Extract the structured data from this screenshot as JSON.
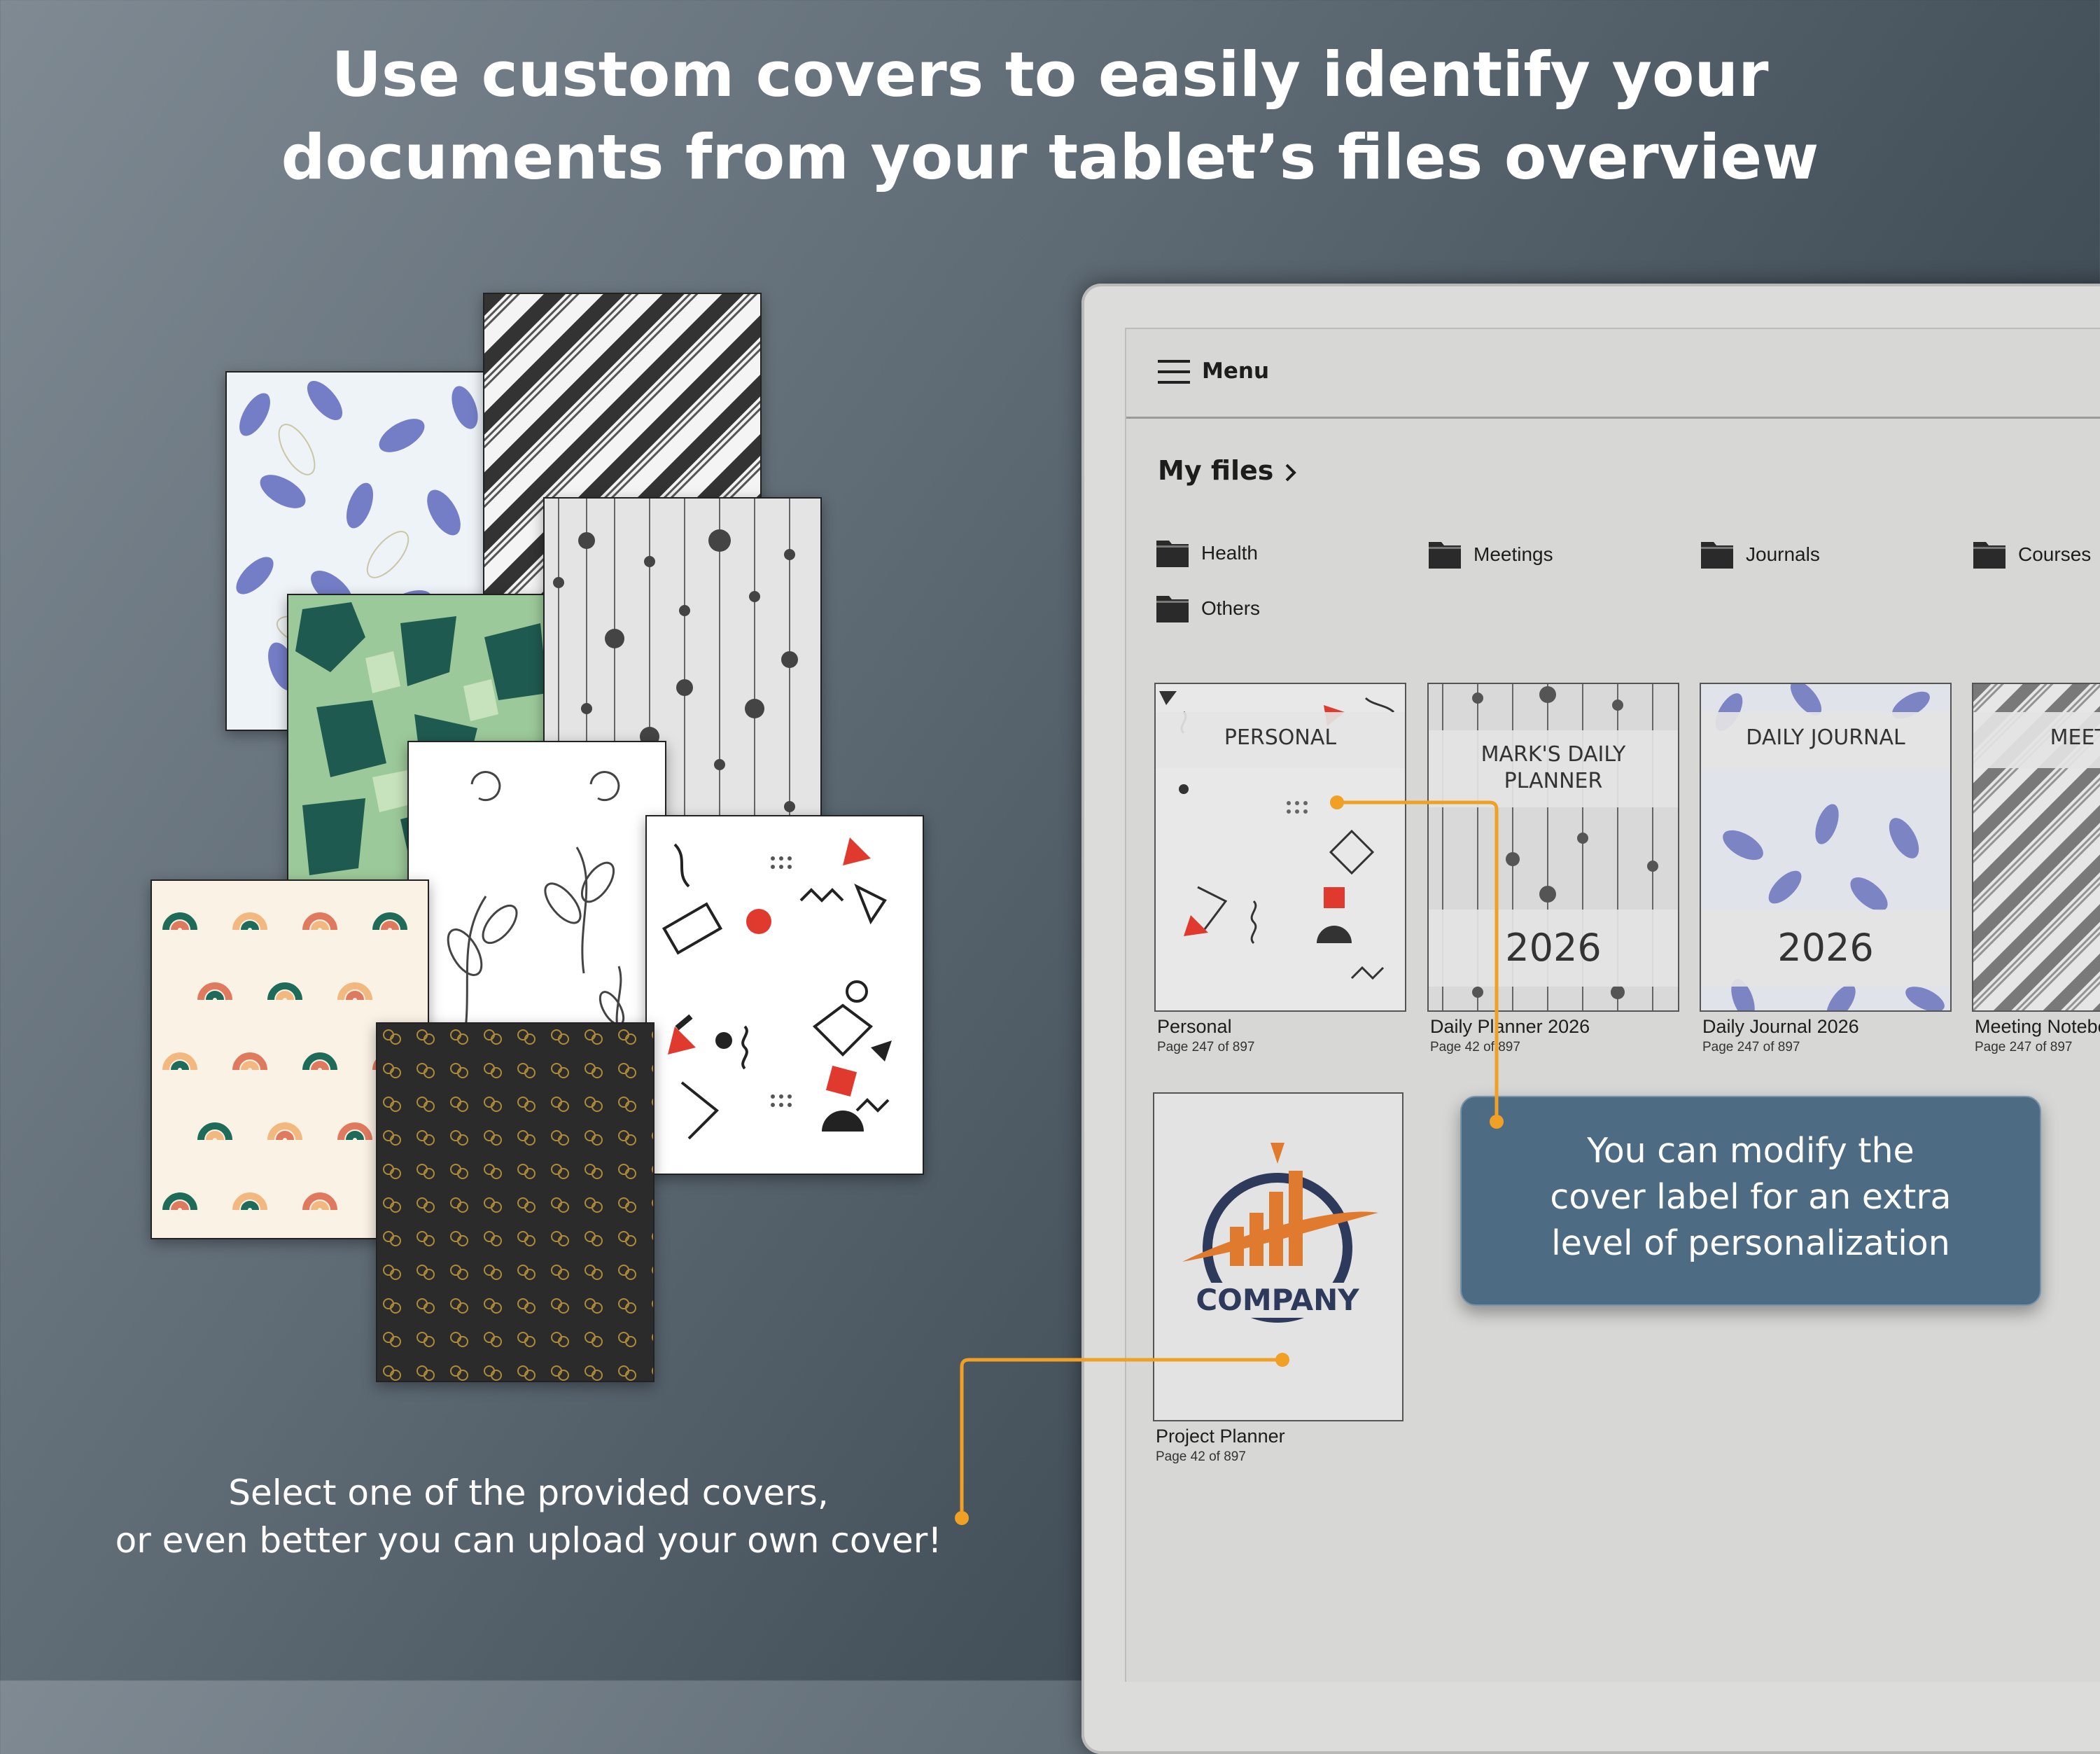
{
  "headline": {
    "line1": "Use custom covers to easily identify your",
    "line2": "documents from your tablet’s files overview"
  },
  "caption": {
    "line1": "Select one of the provided covers,",
    "line2": "or even better you can upload your own cover!"
  },
  "callout": {
    "line1": "You can modify the",
    "line2": "cover label for an extra",
    "line3": "level of personalization"
  },
  "tablet": {
    "menu_label": "Menu",
    "breadcrumb": "My files",
    "folders": [
      "Health",
      "Meetings",
      "Journals",
      "Courses",
      "Others"
    ],
    "documents": [
      {
        "title": "Personal",
        "sub": "Page 247 of 897",
        "cover_label": "PERSONAL"
      },
      {
        "title": "Daily Planner 2026",
        "sub": "Page 42 of 897",
        "cover_label_1": "MARK'S DAILY",
        "cover_label_2": "PLANNER",
        "year": "2026"
      },
      {
        "title": "Daily Journal 2026",
        "sub": "Page 247 of 897",
        "cover_label": "DAILY JOURNAL",
        "year": "2026"
      },
      {
        "title": "Meeting Notebook",
        "sub": "Page 247 of 897",
        "cover_label": "MEETING"
      },
      {
        "title": "Project Planner",
        "sub": "Page 42 of 897",
        "logo_text": "COMPANY"
      }
    ]
  },
  "colors": {
    "accent_orange": "#f0a024",
    "callout_blue": "#4d6b83",
    "leaf_blue": "#6e78c4",
    "green_dark": "#1f5a50",
    "green_light": "#9cc99a"
  }
}
